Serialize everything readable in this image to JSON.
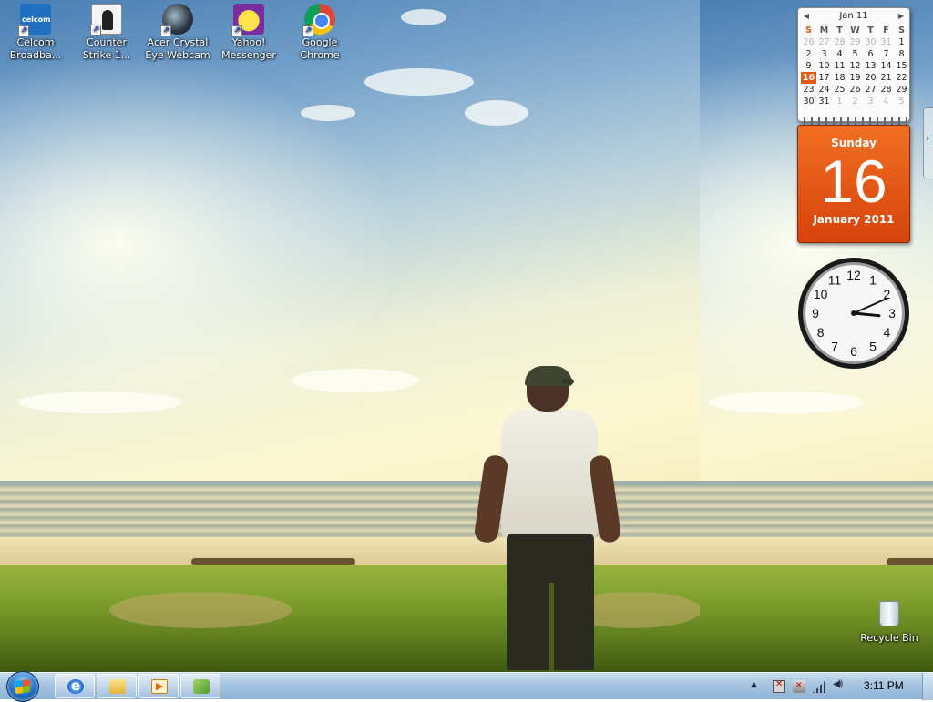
{
  "desktop": {
    "icons": [
      {
        "label": "Celcom Broadba...",
        "icon": "celcom-broadband-icon"
      },
      {
        "label": "Counter Strike 1...",
        "icon": "counter-strike-icon"
      },
      {
        "label": "Acer Crystal Eye Webcam",
        "icon": "webcam-icon"
      },
      {
        "label": "Yahoo! Messenger",
        "icon": "yahoo-messenger-icon"
      },
      {
        "label": "Google Chrome",
        "icon": "chrome-icon"
      }
    ],
    "recycle_bin": {
      "label": "Recycle Bin",
      "icon": "recycle-bin-icon"
    }
  },
  "calendar_gadget": {
    "month_label": "Jan 11",
    "prev_glyph": "◀",
    "next_glyph": "▶",
    "weekdays": [
      "S",
      "M",
      "T",
      "W",
      "T",
      "F",
      "S"
    ],
    "weeks": [
      [
        "26",
        "27",
        "28",
        "29",
        "30",
        "31",
        "1"
      ],
      [
        "2",
        "3",
        "4",
        "5",
        "6",
        "7",
        "8"
      ],
      [
        "9",
        "10",
        "11",
        "12",
        "13",
        "14",
        "15"
      ],
      [
        "16",
        "17",
        "18",
        "19",
        "20",
        "21",
        "22"
      ],
      [
        "23",
        "24",
        "25",
        "26",
        "27",
        "28",
        "29"
      ],
      [
        "30",
        "31",
        "1",
        "2",
        "3",
        "4",
        "5"
      ]
    ],
    "today": "16",
    "day_name": "Sunday",
    "day_number": "16",
    "month_year": "January 2011",
    "accent_color": "#e25a18"
  },
  "clock_gadget": {
    "numerals": [
      "12",
      "1",
      "2",
      "3",
      "4",
      "5",
      "6",
      "7",
      "8",
      "9",
      "10",
      "11"
    ],
    "time": {
      "hour": 3,
      "minute": 11
    }
  },
  "taskbar": {
    "start_label": "Start",
    "pinned": [
      {
        "name": "internet-explorer-icon"
      },
      {
        "name": "windows-explorer-icon"
      },
      {
        "name": "windows-media-player-icon"
      },
      {
        "name": "gadgets-icon"
      }
    ],
    "tray": {
      "show_hidden_glyph": "▲",
      "icons": [
        "action-center-flag-icon",
        "power-icon",
        "network-signal-icon",
        "volume-icon"
      ],
      "time": "3:11 PM"
    }
  }
}
